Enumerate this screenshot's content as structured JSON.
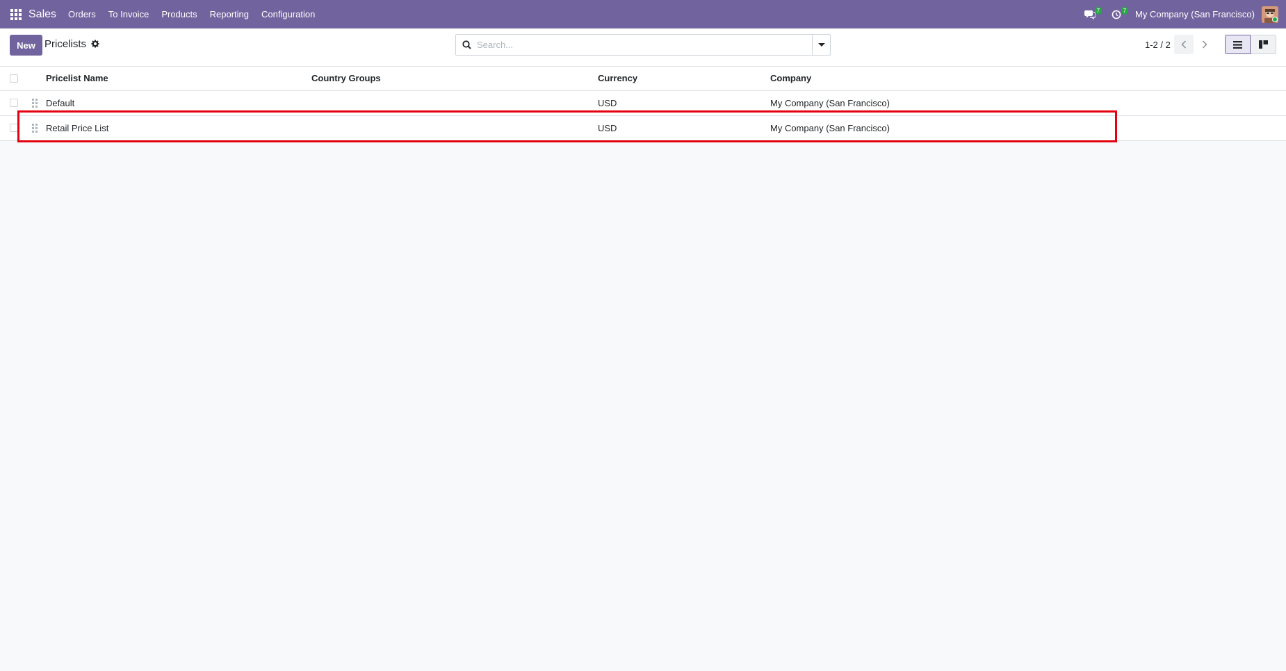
{
  "navbar": {
    "app_name": "Sales",
    "menu": [
      "Orders",
      "To Invoice",
      "Products",
      "Reporting",
      "Configuration"
    ],
    "messages_count": "7",
    "activities_count": "7",
    "company": "My Company (San Francisco)"
  },
  "control_panel": {
    "new_label": "New",
    "title": "Pricelists",
    "search_placeholder": "Search...",
    "pager": "1-2 / 2"
  },
  "table": {
    "headers": {
      "name": "Pricelist Name",
      "country_groups": "Country Groups",
      "currency": "Currency",
      "company": "Company"
    },
    "rows": [
      {
        "name": "Default",
        "country_groups": "",
        "currency": "USD",
        "company": "My Company (San Francisco)"
      },
      {
        "name": "Retail Price List",
        "country_groups": "",
        "currency": "USD",
        "company": "My Company (San Francisco)"
      }
    ]
  },
  "colors": {
    "brand": "#71639e",
    "highlight": "#e3000f",
    "badge": "#28a745"
  }
}
